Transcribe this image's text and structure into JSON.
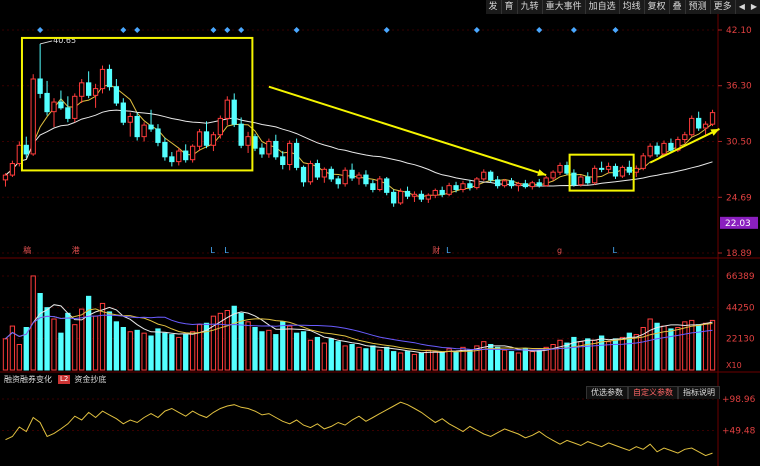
{
  "toolbar": {
    "items": [
      "发",
      "育",
      "九转",
      "重大事件",
      "加自选",
      "均线",
      "复权",
      "叠",
      "预测",
      "更多"
    ],
    "arrow_left": "◀",
    "arrow_right": "▶"
  },
  "price_axis": {
    "ticks": [
      "42.10",
      "36.30",
      "30.50",
      "24.69",
      "18.89"
    ],
    "current_price": "22.03",
    "current_price_color": "#8a1fbf"
  },
  "volume_axis": {
    "ticks": [
      "66389",
      "44250",
      "22130"
    ],
    "unit": "X10"
  },
  "indicator_axis": {
    "ticks": [
      "+98.96",
      "+49.48"
    ]
  },
  "subpanel_tabs": {
    "margin_change": "融资融券变化",
    "badge": "L2",
    "capital_bottom": "资金抄底"
  },
  "indicator_tabs": {
    "optimized": "优选参数",
    "custom": "自定义参数",
    "help": "指标说明"
  },
  "event_markers": [
    {
      "label": "稿",
      "index": 3,
      "color": "#e05050"
    },
    {
      "label": "港",
      "index": 10,
      "color": "#e05050"
    },
    {
      "label": "L",
      "index": 30,
      "color": "#4ab0ff"
    },
    {
      "label": "L",
      "index": 32,
      "color": "#4ab0ff"
    },
    {
      "label": "财",
      "index": 62,
      "color": "#e05050"
    },
    {
      "label": "L",
      "index": 64,
      "color": "#4ab0ff"
    },
    {
      "label": "g",
      "index": 80,
      "color": "#e05050"
    },
    {
      "label": "L",
      "index": 88,
      "color": "#4ab0ff"
    }
  ],
  "colors": {
    "up": "#ff3c3c",
    "down": "#54ffff",
    "ma_short": "#e0c040",
    "ma_long": "#e8e8e8",
    "annotation": "#f5f500",
    "diamond": "#4aa8ff",
    "grid": "#3a0000"
  },
  "chart_data": {
    "type": "candlestick",
    "ylim": [
      18.89,
      42.1
    ],
    "high_label": "40.65",
    "high_index": 5,
    "diamond_indices": [
      5,
      17,
      19,
      30,
      32,
      34,
      42,
      55,
      68,
      77,
      82,
      88
    ],
    "candles": [
      [
        26.5,
        27.2,
        25.8,
        27.0
      ],
      [
        27.0,
        28.5,
        26.8,
        28.2
      ],
      [
        28.2,
        30.5,
        27.9,
        30.1
      ],
      [
        30.1,
        31.0,
        28.8,
        29.2
      ],
      [
        29.2,
        37.5,
        29.0,
        37.0
      ],
      [
        37.0,
        40.65,
        35.0,
        35.5
      ],
      [
        35.5,
        36.8,
        33.2,
        33.6
      ],
      [
        33.6,
        35.0,
        32.0,
        34.6
      ],
      [
        34.6,
        35.8,
        33.8,
        34.0
      ],
      [
        34.0,
        35.2,
        32.5,
        32.9
      ],
      [
        32.9,
        35.5,
        32.5,
        35.2
      ],
      [
        35.2,
        37.0,
        34.5,
        36.6
      ],
      [
        36.6,
        37.8,
        35.0,
        35.3
      ],
      [
        35.3,
        36.5,
        34.0,
        36.0
      ],
      [
        36.0,
        38.4,
        35.5,
        38.0
      ],
      [
        38.0,
        38.5,
        35.8,
        36.2
      ],
      [
        36.2,
        37.0,
        34.2,
        34.5
      ],
      [
        34.5,
        35.0,
        32.2,
        32.5
      ],
      [
        32.5,
        33.5,
        31.0,
        33.1
      ],
      [
        33.1,
        33.5,
        30.6,
        31.0
      ],
      [
        31.0,
        32.5,
        30.5,
        32.2
      ],
      [
        32.2,
        33.8,
        31.5,
        31.8
      ],
      [
        31.8,
        32.3,
        30.0,
        30.4
      ],
      [
        30.4,
        30.9,
        28.5,
        28.9
      ],
      [
        28.9,
        29.4,
        27.9,
        28.4
      ],
      [
        28.4,
        29.8,
        28.0,
        29.5
      ],
      [
        29.5,
        30.2,
        28.3,
        28.6
      ],
      [
        28.6,
        30.2,
        28.3,
        30.0
      ],
      [
        30.0,
        31.8,
        29.5,
        31.5
      ],
      [
        31.5,
        32.6,
        29.8,
        30.1
      ],
      [
        30.1,
        31.5,
        29.5,
        31.2
      ],
      [
        31.2,
        33.2,
        30.8,
        32.9
      ],
      [
        32.9,
        35.2,
        32.2,
        34.8
      ],
      [
        34.8,
        35.5,
        32.0,
        32.3
      ],
      [
        32.3,
        33.0,
        29.8,
        30.1
      ],
      [
        30.1,
        31.5,
        29.3,
        31.0
      ],
      [
        31.0,
        31.3,
        29.5,
        29.8
      ],
      [
        29.8,
        30.3,
        28.8,
        29.2
      ],
      [
        29.2,
        30.8,
        28.8,
        30.5
      ],
      [
        30.5,
        31.2,
        28.6,
        28.9
      ],
      [
        28.9,
        29.5,
        27.6,
        28.1
      ],
      [
        28.1,
        30.6,
        27.5,
        30.3
      ],
      [
        30.3,
        30.8,
        27.5,
        27.8
      ],
      [
        27.8,
        28.0,
        25.8,
        26.3
      ],
      [
        26.3,
        28.5,
        26.0,
        28.2
      ],
      [
        28.2,
        28.6,
        26.5,
        26.8
      ],
      [
        26.8,
        27.8,
        26.2,
        27.6
      ],
      [
        27.6,
        27.9,
        26.3,
        26.6
      ],
      [
        26.6,
        26.9,
        25.6,
        26.1
      ],
      [
        26.1,
        27.8,
        25.8,
        27.5
      ],
      [
        27.5,
        28.2,
        26.4,
        26.7
      ],
      [
        26.7,
        27.3,
        26.0,
        27.0
      ],
      [
        27.0,
        27.5,
        25.8,
        26.1
      ],
      [
        26.1,
        26.5,
        25.2,
        25.5
      ],
      [
        25.5,
        26.9,
        25.3,
        26.6
      ],
      [
        26.6,
        26.8,
        24.9,
        25.2
      ],
      [
        25.2,
        25.5,
        23.7,
        24.1
      ],
      [
        24.1,
        25.6,
        23.9,
        25.3
      ],
      [
        25.3,
        25.8,
        24.5,
        24.8
      ],
      [
        24.8,
        25.3,
        24.2,
        25.0
      ],
      [
        25.0,
        25.4,
        24.2,
        24.5
      ],
      [
        24.5,
        25.1,
        24.1,
        24.9
      ],
      [
        24.9,
        25.6,
        24.6,
        25.4
      ],
      [
        25.4,
        25.8,
        24.7,
        25.0
      ],
      [
        25.0,
        26.2,
        24.8,
        25.9
      ],
      [
        25.9,
        26.3,
        25.2,
        25.5
      ],
      [
        25.5,
        26.4,
        25.2,
        26.1
      ],
      [
        26.1,
        26.5,
        25.4,
        25.7
      ],
      [
        25.7,
        26.8,
        25.5,
        26.6
      ],
      [
        26.6,
        27.6,
        26.4,
        27.3
      ],
      [
        27.3,
        27.5,
        26.2,
        26.5
      ],
      [
        26.5,
        26.9,
        25.6,
        25.9
      ],
      [
        25.9,
        26.6,
        25.7,
        26.4
      ],
      [
        26.4,
        26.7,
        25.6,
        25.9
      ],
      [
        25.9,
        26.3,
        25.3,
        26.1
      ],
      [
        26.1,
        26.5,
        25.6,
        25.8
      ],
      [
        25.8,
        26.4,
        25.5,
        26.2
      ],
      [
        26.2,
        26.6,
        25.7,
        25.9
      ],
      [
        25.9,
        26.9,
        25.8,
        26.7
      ],
      [
        26.7,
        27.5,
        26.4,
        27.3
      ],
      [
        27.3,
        28.3,
        27.0,
        28.0
      ],
      [
        28.0,
        28.4,
        27.0,
        27.2
      ],
      [
        27.2,
        27.6,
        25.8,
        26.0
      ],
      [
        26.0,
        27.0,
        25.8,
        26.8
      ],
      [
        26.8,
        27.3,
        26.0,
        26.2
      ],
      [
        26.2,
        28.0,
        26.0,
        27.7
      ],
      [
        27.7,
        28.4,
        27.3,
        27.6
      ],
      [
        27.6,
        28.3,
        27.2,
        27.9
      ],
      [
        27.9,
        28.2,
        26.6,
        26.9
      ],
      [
        26.9,
        28.0,
        26.7,
        27.8
      ],
      [
        27.8,
        28.5,
        27.0,
        27.3
      ],
      [
        27.3,
        28.0,
        26.8,
        27.7
      ],
      [
        27.7,
        29.3,
        27.5,
        29.0
      ],
      [
        29.0,
        30.3,
        28.8,
        30.0
      ],
      [
        30.0,
        30.4,
        28.9,
        29.2
      ],
      [
        29.2,
        30.6,
        29.0,
        30.3
      ],
      [
        30.3,
        30.8,
        29.3,
        29.6
      ],
      [
        29.6,
        31.0,
        29.4,
        30.7
      ],
      [
        30.7,
        31.5,
        30.3,
        31.2
      ],
      [
        31.2,
        33.2,
        31.0,
        32.9
      ],
      [
        32.9,
        33.6,
        31.6,
        31.9
      ],
      [
        31.9,
        32.6,
        31.1,
        32.3
      ],
      [
        32.3,
        33.8,
        32.1,
        33.5
      ]
    ],
    "volume": {
      "ylim": [
        0,
        72000
      ],
      "values": [
        22000,
        31000,
        18000,
        30000,
        66389,
        54000,
        44000,
        36000,
        26000,
        40000,
        32000,
        43000,
        52000,
        38000,
        47000,
        41000,
        34000,
        30000,
        27000,
        28000,
        26000,
        24000,
        29000,
        26000,
        25000,
        23000,
        25000,
        27000,
        32000,
        33000,
        38000,
        40000,
        42000,
        45000,
        40000,
        34000,
        30000,
        27000,
        28000,
        25000,
        34000,
        31000,
        26000,
        27000,
        21000,
        23000,
        19000,
        22000,
        20000,
        17000,
        18000,
        16000,
        15000,
        17000,
        14000,
        16000,
        13000,
        12000,
        13000,
        11000,
        12000,
        14000,
        13000,
        12000,
        15000,
        13000,
        16000,
        14000,
        17000,
        20000,
        18000,
        16000,
        14000,
        13000,
        12000,
        15000,
        13000,
        14000,
        16000,
        18000,
        21000,
        19000,
        23000,
        20000,
        22000,
        21000,
        24000,
        20000,
        22000,
        23000,
        26000,
        25000,
        30000,
        36000,
        33000,
        31000,
        29000,
        30000,
        34000,
        35000,
        32000,
        33000,
        35000
      ]
    },
    "indicator": {
      "ylim": [
        0,
        110
      ],
      "values": [
        35,
        40,
        55,
        48,
        70,
        62,
        40,
        45,
        52,
        60,
        72,
        66,
        78,
        70,
        80,
        74,
        68,
        60,
        66,
        62,
        70,
        76,
        70,
        80,
        84,
        78,
        72,
        80,
        74,
        70,
        78,
        84,
        88,
        90,
        86,
        84,
        80,
        74,
        76,
        70,
        64,
        60,
        66,
        58,
        54,
        60,
        52,
        56,
        62,
        58,
        66,
        72,
        64,
        70,
        76,
        82,
        88,
        94,
        90,
        84,
        78,
        70,
        62,
        68,
        60,
        54,
        48,
        56,
        50,
        44,
        40,
        46,
        52,
        48,
        44,
        38,
        42,
        48,
        40,
        34,
        28,
        34,
        30,
        26,
        32,
        28,
        24,
        30,
        26,
        22,
        18,
        24,
        20,
        28,
        16,
        22,
        18,
        14,
        20,
        22,
        16,
        10,
        14
      ]
    }
  }
}
